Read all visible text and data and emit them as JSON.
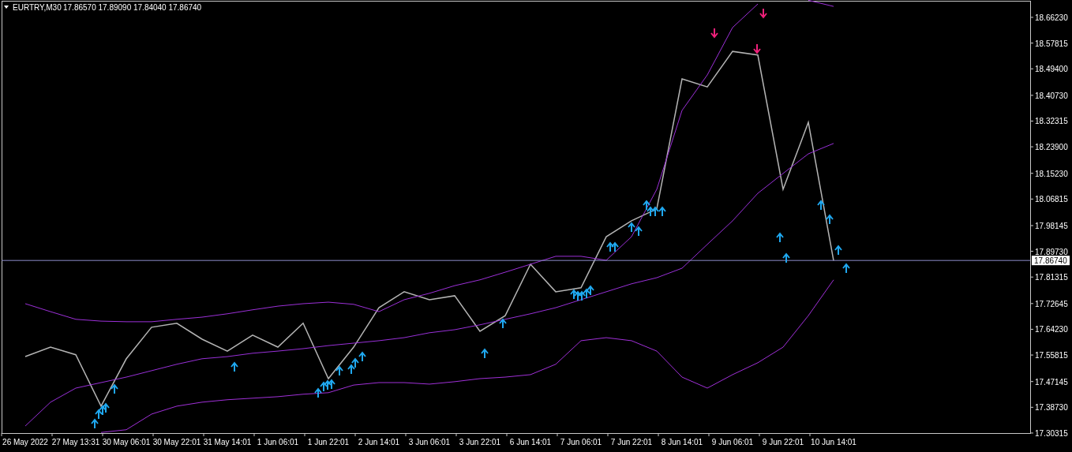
{
  "chart": {
    "symbol": "EURTRY,M30",
    "ohlc": "17.86570 17.89090 17.84040 17.86740",
    "chart_data": {
      "type": "line",
      "ylim": [
        17.303,
        18.719
      ],
      "categories": [
        "26 May 2022",
        null,
        "27 May 13:31",
        null,
        "30 May 06:01",
        null,
        "30 May 22:01",
        null,
        "31 May 14:01",
        null,
        "1 Jun 06:01",
        null,
        "1 Jun 22:01",
        null,
        "2 Jun 14:01",
        null,
        "3 Jun 06:01",
        null,
        "3 Jun 22:01",
        null,
        "6 Jun 14:01",
        null,
        "7 Jun 06:01",
        null,
        "7 Jun 22:01",
        null,
        "8 Jun 14:01",
        null,
        "9 Jun 06:01",
        null,
        "9 Jun 22:01",
        null,
        "10 Jun 14:01"
      ],
      "series": [
        {
          "color": "#b4b4b4",
          "values": [
            17.553,
            17.584,
            17.559,
            17.391,
            17.546,
            17.649,
            17.662,
            17.61,
            17.571,
            17.623,
            17.584,
            17.662,
            17.481,
            17.584,
            17.713,
            17.765,
            17.739,
            17.752,
            17.636,
            17.687,
            17.855,
            17.765,
            17.778,
            17.945,
            17.997,
            18.036,
            18.461,
            18.435,
            18.551,
            18.539,
            18.1,
            18.319,
            17.867
          ]
        },
        {
          "color": "#9c30d8",
          "values": [
            17.726,
            17.7,
            17.675,
            17.669,
            17.667,
            17.667,
            17.675,
            17.682,
            17.693,
            17.706,
            17.718,
            17.726,
            17.731,
            17.724,
            17.7,
            17.739,
            17.76,
            17.785,
            17.804,
            17.829,
            17.855,
            17.881,
            17.881,
            17.868,
            17.945,
            18.1,
            18.358,
            18.474,
            18.629,
            18.706,
            null,
            18.718,
            18.698
          ]
        },
        {
          "color": "#9830d8",
          "values": [
            17.326,
            17.404,
            17.45,
            17.468,
            17.486,
            17.507,
            17.528,
            17.546,
            17.553,
            17.564,
            17.571,
            17.579,
            17.589,
            17.597,
            17.605,
            17.615,
            17.631,
            17.641,
            17.657,
            17.675,
            17.693,
            17.713,
            17.739,
            17.765,
            17.791,
            17.811,
            17.842,
            17.92,
            17.997,
            18.087,
            18.152,
            18.216,
            18.25
          ]
        },
        {
          "color": "#a030d8",
          "values": [
            null,
            null,
            null,
            17.305,
            17.314,
            17.365,
            17.391,
            17.404,
            17.412,
            17.417,
            17.422,
            17.43,
            17.435,
            17.46,
            17.468,
            17.468,
            17.463,
            17.471,
            17.481,
            17.486,
            17.494,
            17.528,
            17.605,
            17.615,
            17.605,
            17.571,
            17.486,
            17.45,
            17.494,
            17.533,
            17.584,
            17.687,
            17.804
          ]
        }
      ],
      "yticks": [
        {
          "value": 18.6623,
          "label": "18.66230"
        },
        {
          "value": 18.57815,
          "label": "18.57815"
        },
        {
          "value": 18.494,
          "label": "18.49400"
        },
        {
          "value": 18.4073,
          "label": "18.40730"
        },
        {
          "value": 18.32315,
          "label": "18.32315"
        },
        {
          "value": 18.239,
          "label": "18.23900"
        },
        {
          "value": 18.1523,
          "label": "18.15230"
        },
        {
          "value": 18.06815,
          "label": "18.06815"
        },
        {
          "value": 17.98145,
          "label": "17.98145"
        },
        {
          "value": 17.8973,
          "label": "17.89730"
        },
        {
          "value": 17.81315,
          "label": "17.81315"
        },
        {
          "value": 17.72645,
          "label": "17.72645"
        },
        {
          "value": 17.6423,
          "label": "17.64230"
        },
        {
          "value": 17.55815,
          "label": "17.55815"
        },
        {
          "value": 17.47145,
          "label": "17.47145"
        },
        {
          "value": 17.3873,
          "label": "17.38730"
        },
        {
          "value": 17.30315,
          "label": "17.30315"
        }
      ],
      "ref_lines": [
        {
          "axis": "y",
          "value": 17.8674,
          "label": "17.86740"
        }
      ]
    }
  }
}
